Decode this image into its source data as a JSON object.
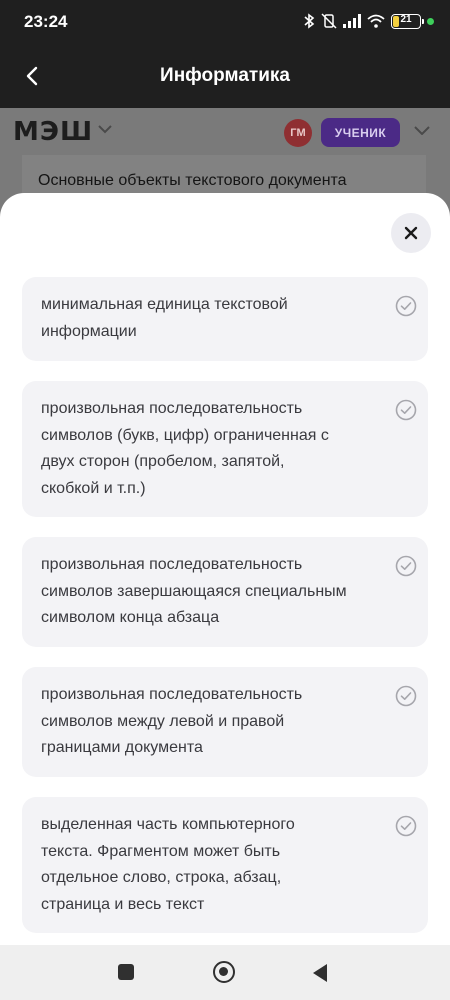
{
  "status_bar": {
    "time": "23:24",
    "battery": "21"
  },
  "app_bar": {
    "title": "Информатика"
  },
  "background_page": {
    "logo": "МЭШ",
    "avatar_initials": "ГМ",
    "role_label": "УЧЕНИК",
    "document_title": "Основные объекты текстового документа"
  },
  "sheet": {
    "options": [
      {
        "text": "минимальная единица текстовой\nинформации"
      },
      {
        "text": "произвольная последовательность\nсимволов (букв, цифр) ограниченная с\nдвух сторон  (пробелом, запятой,\nскобкой и т.п.)"
      },
      {
        "text": "произвольная последовательность\nсимволов завершающаяся специальным\nсимволом конца абзаца"
      },
      {
        "text": "произвольная последовательность\nсимволов между левой и правой\nграницами документа"
      },
      {
        "text": "выделенная часть компьютерного\nтекста. Фрагментом может быть\nотдельное слово, строка, абзац,\nстраница и весь текст"
      }
    ]
  },
  "colors": {
    "accent_purple": "#4b2a86",
    "avatar_red": "#8f2f32",
    "option_bg": "#f3f3f6",
    "check_gray": "#a6a6ac"
  }
}
